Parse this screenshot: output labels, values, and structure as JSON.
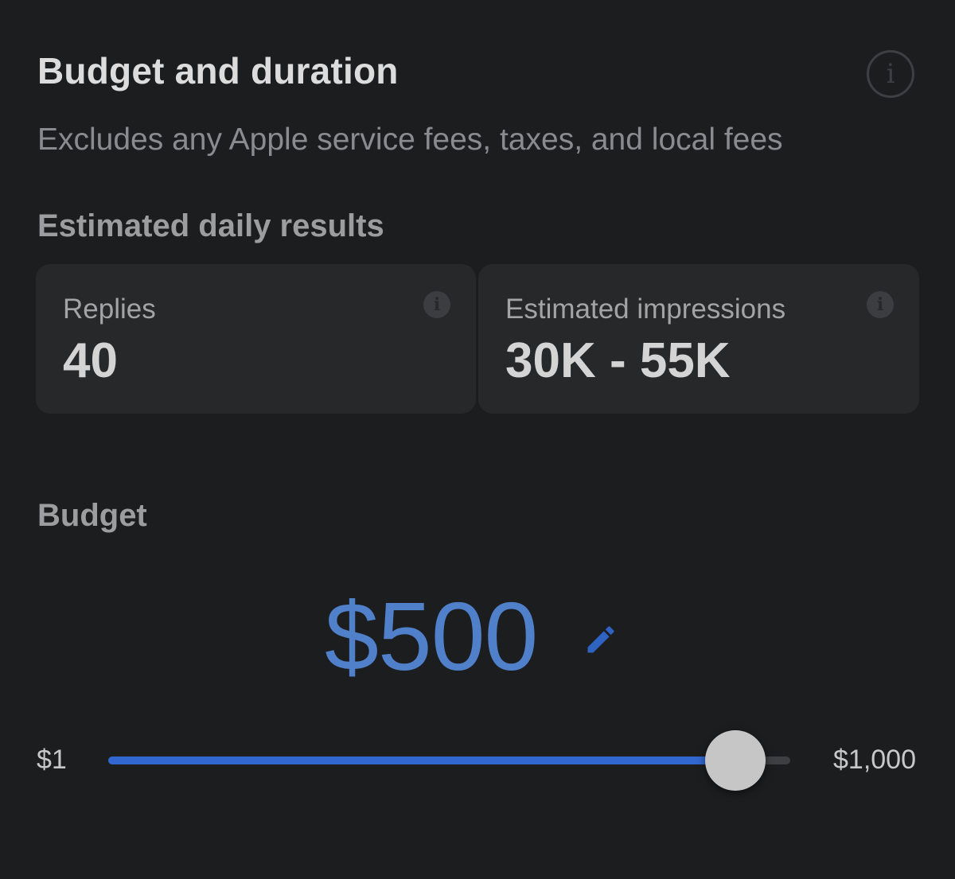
{
  "header": {
    "title": "Budget and duration",
    "info_icon": "info-icon",
    "subtitle": "Excludes any Apple service fees, taxes, and local fees"
  },
  "estimates": {
    "heading": "Estimated daily results",
    "cards": [
      {
        "label": "Replies",
        "value": "40",
        "icon": "info-icon"
      },
      {
        "label": "Estimated impressions",
        "value": "30K - 55K",
        "icon": "info-icon"
      }
    ]
  },
  "budget": {
    "heading": "Budget",
    "amount": "$500",
    "edit_icon": "pencil-icon",
    "min_label": "$1",
    "max_label": "$1,000",
    "slider_value": 0.92
  },
  "colors": {
    "accent": "#4f80c9",
    "slider_fill": "#3267cf",
    "background": "#1c1d1f"
  }
}
